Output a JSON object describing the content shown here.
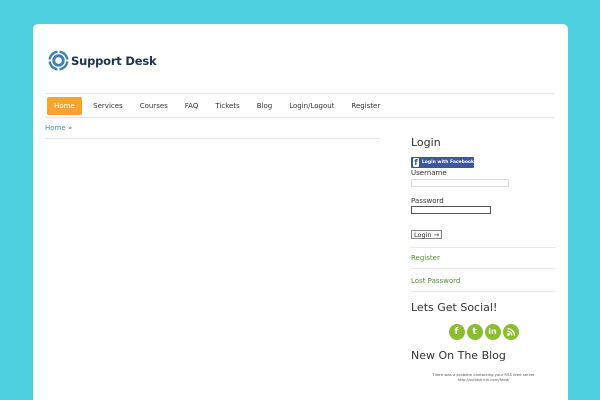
{
  "logo": {
    "text": "Support Desk"
  },
  "nav": {
    "items": [
      {
        "label": "Home",
        "active": true
      },
      {
        "label": "Services"
      },
      {
        "label": "Courses"
      },
      {
        "label": "FAQ"
      },
      {
        "label": "Tickets"
      },
      {
        "label": "Blog"
      },
      {
        "label": "Login/Logout"
      },
      {
        "label": "Register"
      }
    ]
  },
  "breadcrumb": {
    "home": "Home",
    "sep": "»"
  },
  "sidebar": {
    "login": {
      "title": "Login",
      "facebook_label": "Login with Facebook",
      "username_label": "Username",
      "username_value": "",
      "password_label": "Password",
      "password_value": "",
      "button_label": "Login →",
      "register_link": "Register",
      "lost_password_link": "Lost Password"
    },
    "social": {
      "title": "Lets Get Social!",
      "icons": [
        {
          "name": "facebook-icon",
          "glyph": "f"
        },
        {
          "name": "twitter-icon",
          "glyph": "t"
        },
        {
          "name": "linkedin-icon",
          "glyph": "in"
        },
        {
          "name": "rss-icon",
          "glyph": ""
        }
      ],
      "icon_color": "#8abe2e"
    },
    "blog": {
      "title": "New On The Blog",
      "error_text": "There was a problem contacting your RSS feed server http://solidsk.kin.com/feed/"
    }
  },
  "colors": {
    "background": "#4ecfe0",
    "nav_active": "#f3a530",
    "link": "#5d8a3a",
    "facebook": "#3b5998"
  }
}
